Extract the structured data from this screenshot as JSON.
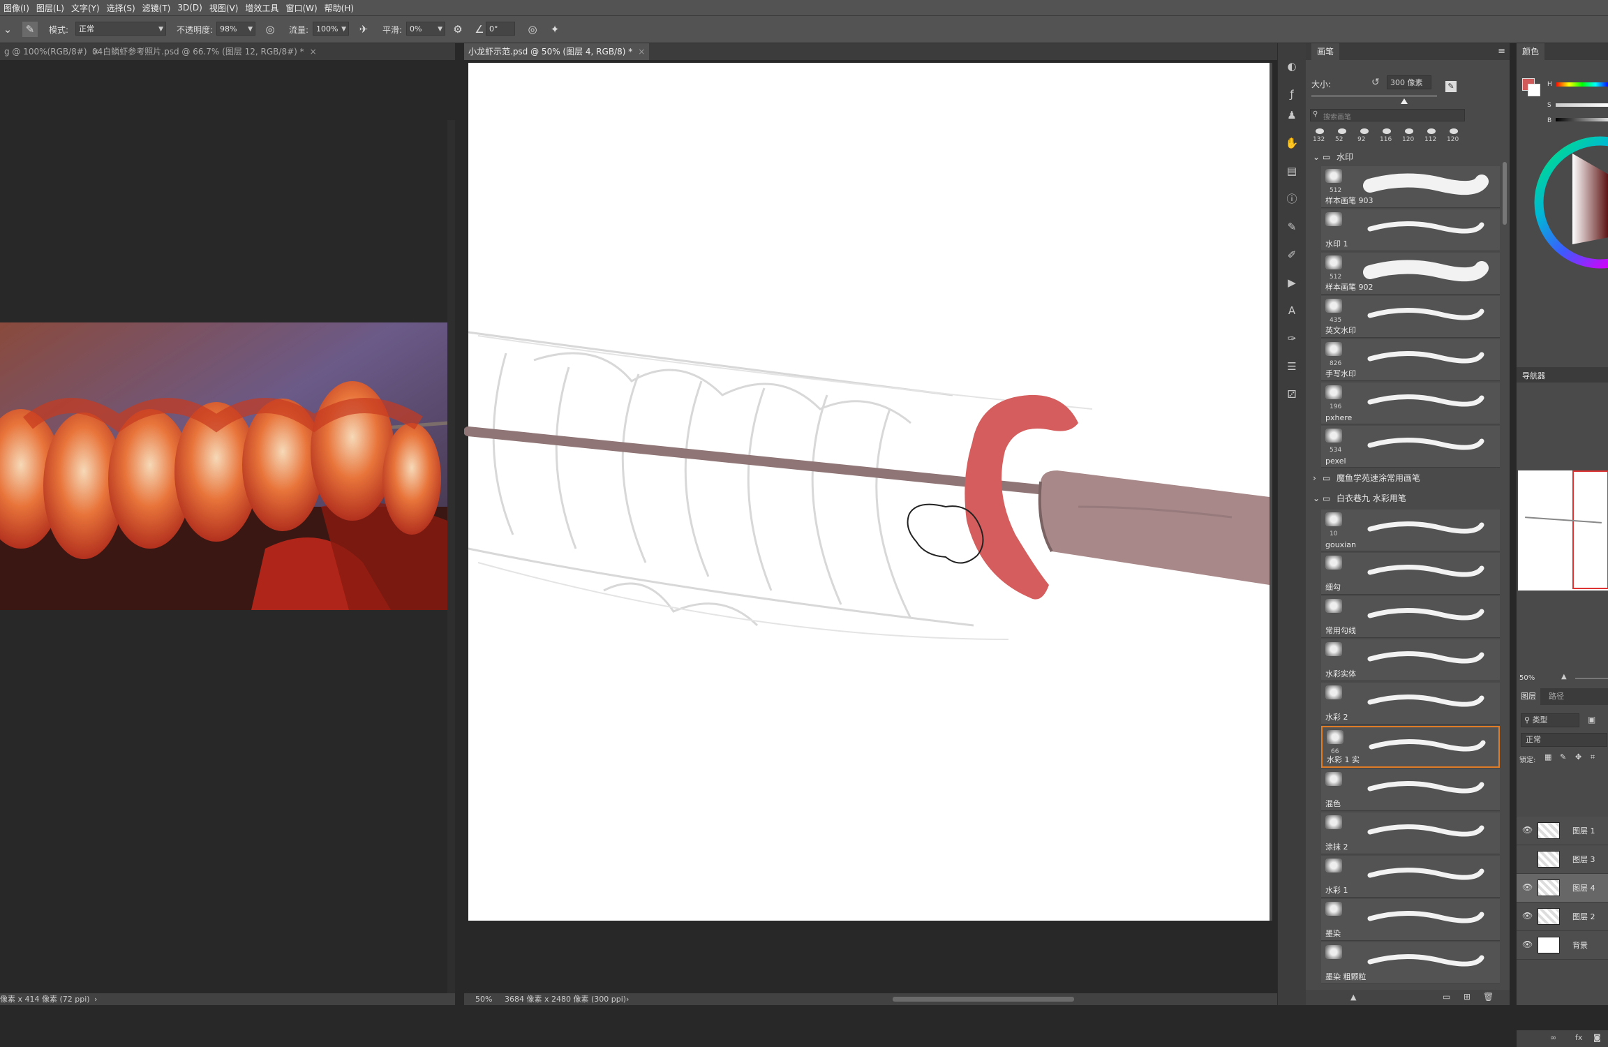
{
  "menubar": {
    "items": [
      "图像(I)",
      "图层(L)",
      "文字(Y)",
      "选择(S)",
      "滤镜(T)",
      "3D(D)",
      "视图(V)",
      "增效工具",
      "窗口(W)",
      "帮助(H)"
    ]
  },
  "options": {
    "mode_label": "模式:",
    "mode_value": "正常",
    "opacity_label": "不透明度:",
    "opacity_value": "98%",
    "flow_label": "流量:",
    "flow_value": "100%",
    "smoothing_label": "平滑:",
    "smoothing_value": "0%",
    "angle_value": "0°"
  },
  "tabs": {
    "left": [
      {
        "label": "g @ 100%(RGB/8#)",
        "close": "×"
      },
      {
        "label": "04白鳞虾参考照片.psd @ 66.7% (图层 12, RGB/8#) *",
        "close": "×"
      }
    ],
    "center": {
      "label": "小龙虾示范.psd @ 50% (图层 4, RGB/8) *",
      "close": "×"
    }
  },
  "status": {
    "left": "像素 x 414 像素 (72 ppi)",
    "left_arrow": "›",
    "zoom": "50%",
    "doc": "3684 像素 x 2480 像素 (300 ppi)",
    "doc_arrow": "›"
  },
  "brush_panel": {
    "title": "画笔",
    "size_label": "大小:",
    "size_value": "300 像素",
    "search_placeholder": "搜索画笔",
    "recent_sizes": [
      "132",
      "52",
      "92",
      "116",
      "120",
      "112",
      "120"
    ],
    "groups": [
      {
        "name": "水印",
        "brushes": [
          {
            "name": "样本画笔 903",
            "size": "512"
          },
          {
            "name": "水印 1",
            "size": ""
          },
          {
            "name": "样本画笔 902",
            "size": "512"
          },
          {
            "name": "英文水印",
            "size": "435"
          },
          {
            "name": "手写水印",
            "size": "826"
          },
          {
            "name": "pxhere",
            "size": "196"
          },
          {
            "name": "pexel",
            "size": "534"
          }
        ]
      },
      {
        "name": "魔鱼学苑速涂常用画笔",
        "brushes": []
      },
      {
        "name": "白衣巷九 水彩用笔",
        "brushes": [
          {
            "name": "gouxian",
            "size": "10"
          },
          {
            "name": "细勾",
            "size": ""
          },
          {
            "name": "常用勾线",
            "size": ""
          },
          {
            "name": "水彩实体",
            "size": ""
          },
          {
            "name": "水彩 2",
            "size": ""
          },
          {
            "name": "水彩 1 实",
            "size": "66"
          },
          {
            "name": "混色",
            "size": ""
          },
          {
            "name": "涂抹 2",
            "size": ""
          },
          {
            "name": "水彩 1",
            "size": ""
          },
          {
            "name": "墨染",
            "size": ""
          },
          {
            "name": "墨染 粗颗粒",
            "size": ""
          }
        ]
      }
    ]
  },
  "color_panel": {
    "title": "颜色",
    "h": "H",
    "s": "S",
    "b": "B",
    "foreground_color": "#d05a5a"
  },
  "navigator": {
    "title": "导航器",
    "zoom": "50%"
  },
  "layers_panel": {
    "tab_layers": "图层",
    "tab_paths": "路径",
    "filter_kind": "类型",
    "blend_mode": "正常",
    "lock_label": "锁定:",
    "layers": [
      {
        "name": "图层 1",
        "visible": true
      },
      {
        "name": "图层 3",
        "visible": false
      },
      {
        "name": "图层 4",
        "visible": true,
        "selected": true
      },
      {
        "name": "图层 2",
        "visible": true
      },
      {
        "name": "背景",
        "visible": true
      }
    ]
  },
  "colors": {
    "accent": "#e07b26",
    "stroke_red": "#d65d5d",
    "handle": "#a88889"
  }
}
